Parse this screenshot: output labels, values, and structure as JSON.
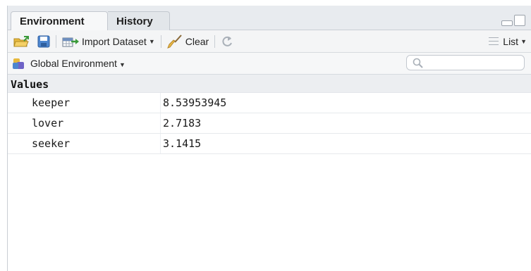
{
  "tabs": [
    {
      "label": "Environment",
      "active": true
    },
    {
      "label": "History",
      "active": false
    }
  ],
  "toolbar": {
    "import_label": "Import Dataset",
    "clear_label": "Clear",
    "view_mode": "List"
  },
  "env": {
    "selector_label": "Global Environment",
    "search_placeholder": ""
  },
  "values": {
    "header": "Values",
    "rows": [
      {
        "name": "keeper",
        "value": "8.53953945"
      },
      {
        "name": "lover",
        "value": "2.7183"
      },
      {
        "name": "seeker",
        "value": "3.1415"
      }
    ]
  },
  "colors": {
    "tabstrip_bg": "#e8ebef",
    "toolbar_bg": "#f4f5f6",
    "section_bg": "#eceef1",
    "accent_green": "#5bab3a",
    "accent_blue": "#3f78c8"
  }
}
